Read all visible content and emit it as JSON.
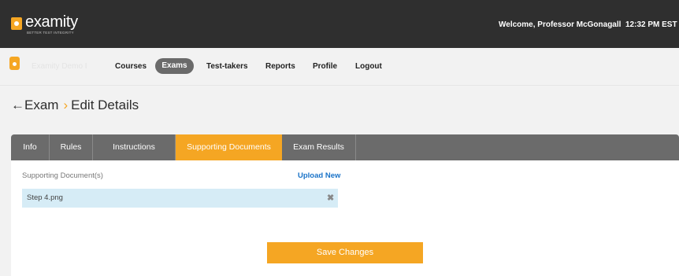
{
  "header": {
    "logo_text": "examity",
    "logo_tagline": "BETTER TEST INTEGRITY",
    "welcome": "Welcome, Professor McGonagall",
    "time": "12:32 PM  EST"
  },
  "nav": {
    "brand_text": "Examity Demo I",
    "items": [
      {
        "label": "Courses"
      },
      {
        "label": "Exams"
      },
      {
        "label": "Test-takers"
      },
      {
        "label": "Reports"
      },
      {
        "label": "Profile"
      },
      {
        "label": "Logout"
      }
    ]
  },
  "breadcrumb": {
    "back_arrow": "←",
    "parent": "Exam",
    "separator": "›",
    "current": "Edit Details"
  },
  "tabs": [
    {
      "label": "Info"
    },
    {
      "label": "Rules"
    },
    {
      "label": "Instructions"
    },
    {
      "label": "Supporting Documents",
      "active": true
    },
    {
      "label": "Exam Results"
    }
  ],
  "documents": {
    "section_label": "Supporting Document(s)",
    "upload_label": "Upload New",
    "files": [
      {
        "name": "Step 4.png",
        "remove_icon": "✖"
      }
    ]
  },
  "actions": {
    "save_label": "Save Changes"
  },
  "colors": {
    "accent": "#f5a623",
    "topbar": "#2f2f2f",
    "tabbar": "#6b6b6b",
    "link": "#1a73c8",
    "file_row": "#d6ecf6"
  }
}
